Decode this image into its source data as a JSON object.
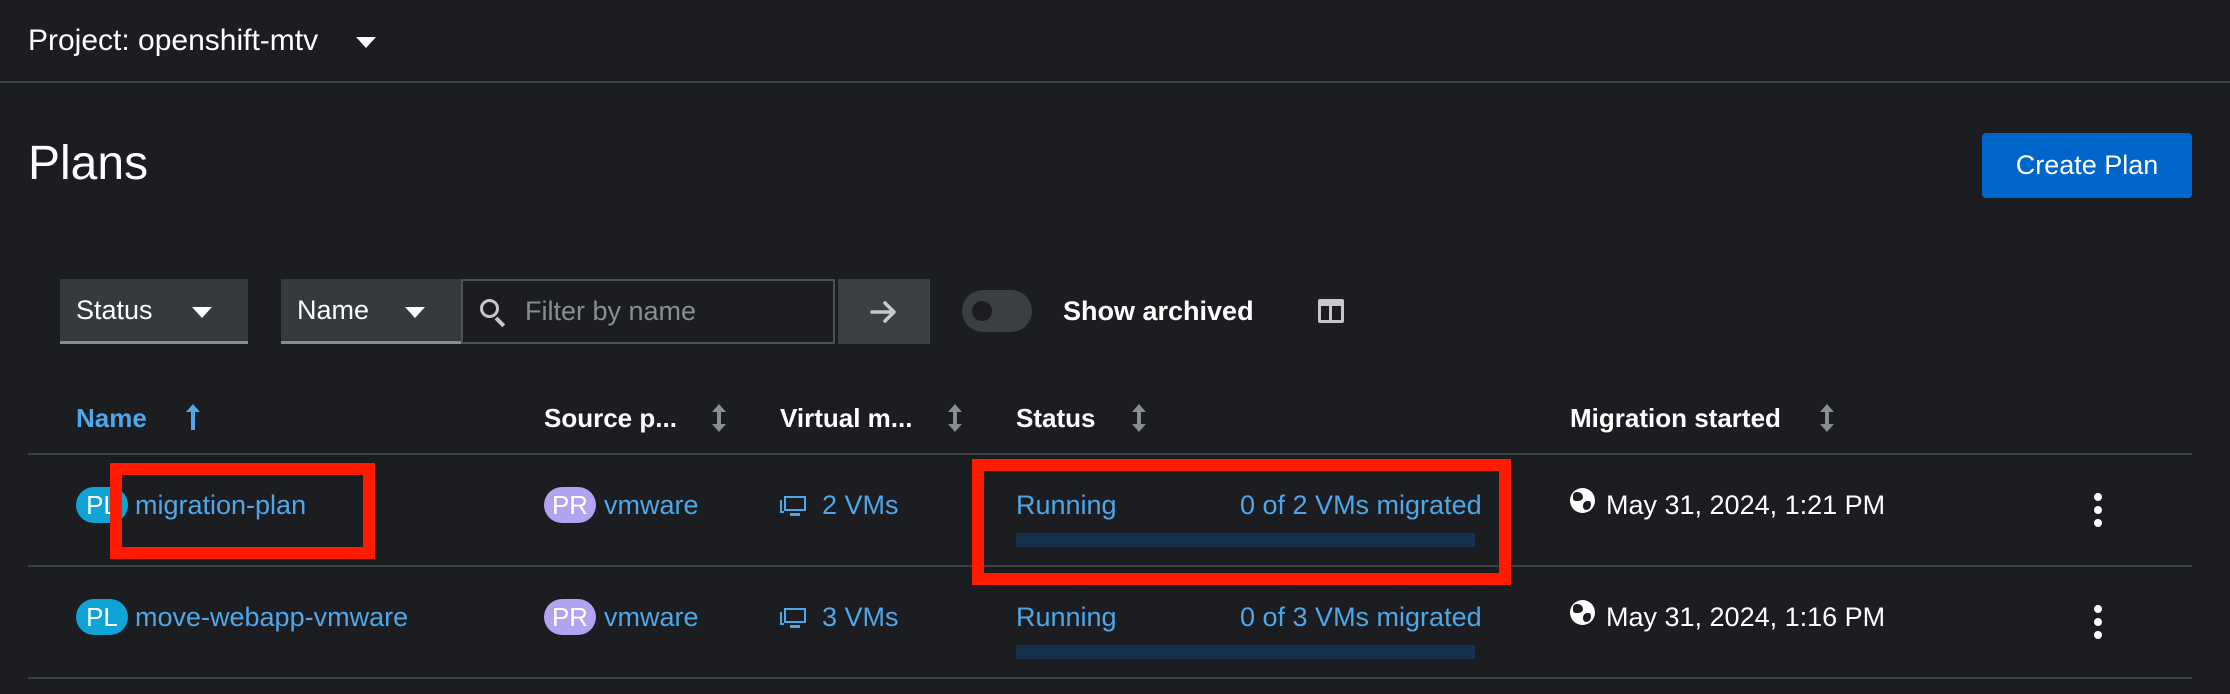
{
  "project": {
    "label": "Project: openshift-mtv"
  },
  "page": {
    "title": "Plans",
    "create_button": "Create Plan"
  },
  "toolbar": {
    "status_filter": "Status",
    "name_filter": "Name",
    "search_placeholder": "Filter by name",
    "show_archived_label": "Show archived",
    "show_archived_on": false
  },
  "table": {
    "columns": [
      "Name",
      "Source p...",
      "Virtual m...",
      "Status",
      "Migration started"
    ],
    "sort": {
      "column": "Name",
      "direction": "ascending"
    },
    "rows": [
      {
        "name_badge": "PL",
        "name": "migration-plan",
        "source_badge": "PR",
        "source": "vmware",
        "vms": "2 VMs",
        "status": "Running",
        "migrated": "0 of 2 VMs migrated",
        "progress": 0,
        "started": "May 31, 2024, 1:21 PM"
      },
      {
        "name_badge": "PL",
        "name": "move-webapp-vmware",
        "source_badge": "PR",
        "source": "vmware",
        "vms": "3 VMs",
        "status": "Running",
        "migrated": "0 of 3 VMs migrated",
        "progress": 0,
        "started": "May 31, 2024, 1:16 PM"
      }
    ]
  },
  "colors": {
    "background": "#1b1d21",
    "link": "#4fa6e8",
    "primary_button": "#0066cc",
    "badge_plan": "#0fa3d6",
    "badge_provider": "#b2a3f0",
    "highlight": "#ff1a00",
    "progress_track": "#16324f"
  }
}
